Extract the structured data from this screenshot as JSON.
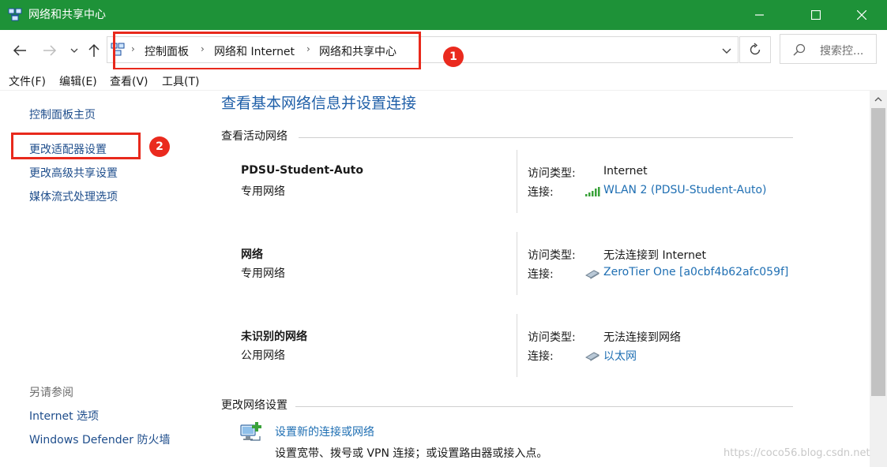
{
  "window": {
    "title": "网络和共享中心",
    "accent_color": "#1e9238"
  },
  "address": {
    "breadcrumbs": [
      "控制面板",
      "网络和 Internet",
      "网络和共享中心"
    ],
    "search_placeholder": "搜索控..."
  },
  "annotations": {
    "marker1": "1",
    "marker2": "2",
    "color": "#e8291c"
  },
  "menu": {
    "file": "文件(F)",
    "edit": "编辑(E)",
    "view": "查看(V)",
    "tools": "工具(T)"
  },
  "sidebar": {
    "items": [
      "控制面板主页",
      "更改适配器设置",
      "更改高级共享设置",
      "媒体流式处理选项"
    ],
    "see_also_label": "另请参阅",
    "see_also": [
      "Internet 选项",
      "Windows Defender 防火墙"
    ]
  },
  "main": {
    "title": "查看基本网络信息并设置连接",
    "active_networks_label": "查看活动网络",
    "access_type_label": "访问类型:",
    "connection_label": "连接:",
    "networks": [
      {
        "name": "PDSU-Student-Auto",
        "type": "专用网络",
        "access": "Internet",
        "connection": "WLAN 2 (PDSU-Student-Auto)",
        "icon": "wifi-signal-icon"
      },
      {
        "name": "网络",
        "type": "专用网络",
        "access": "无法连接到 Internet",
        "connection": "ZeroTier One [a0cbf4b62afc059f]",
        "icon": "ethernet-adapter-icon"
      },
      {
        "name": "未识别的网络",
        "type": "公用网络",
        "access": "无法连接到网络",
        "connection": "以太网",
        "icon": "ethernet-adapter-icon"
      }
    ],
    "change_settings_label": "更改网络设置",
    "setup_link": "设置新的连接或网络",
    "setup_desc": "设置宽带、拨号或 VPN 连接；或设置路由器或接入点。"
  },
  "watermark": "https://coco56.blog.csdn.net"
}
